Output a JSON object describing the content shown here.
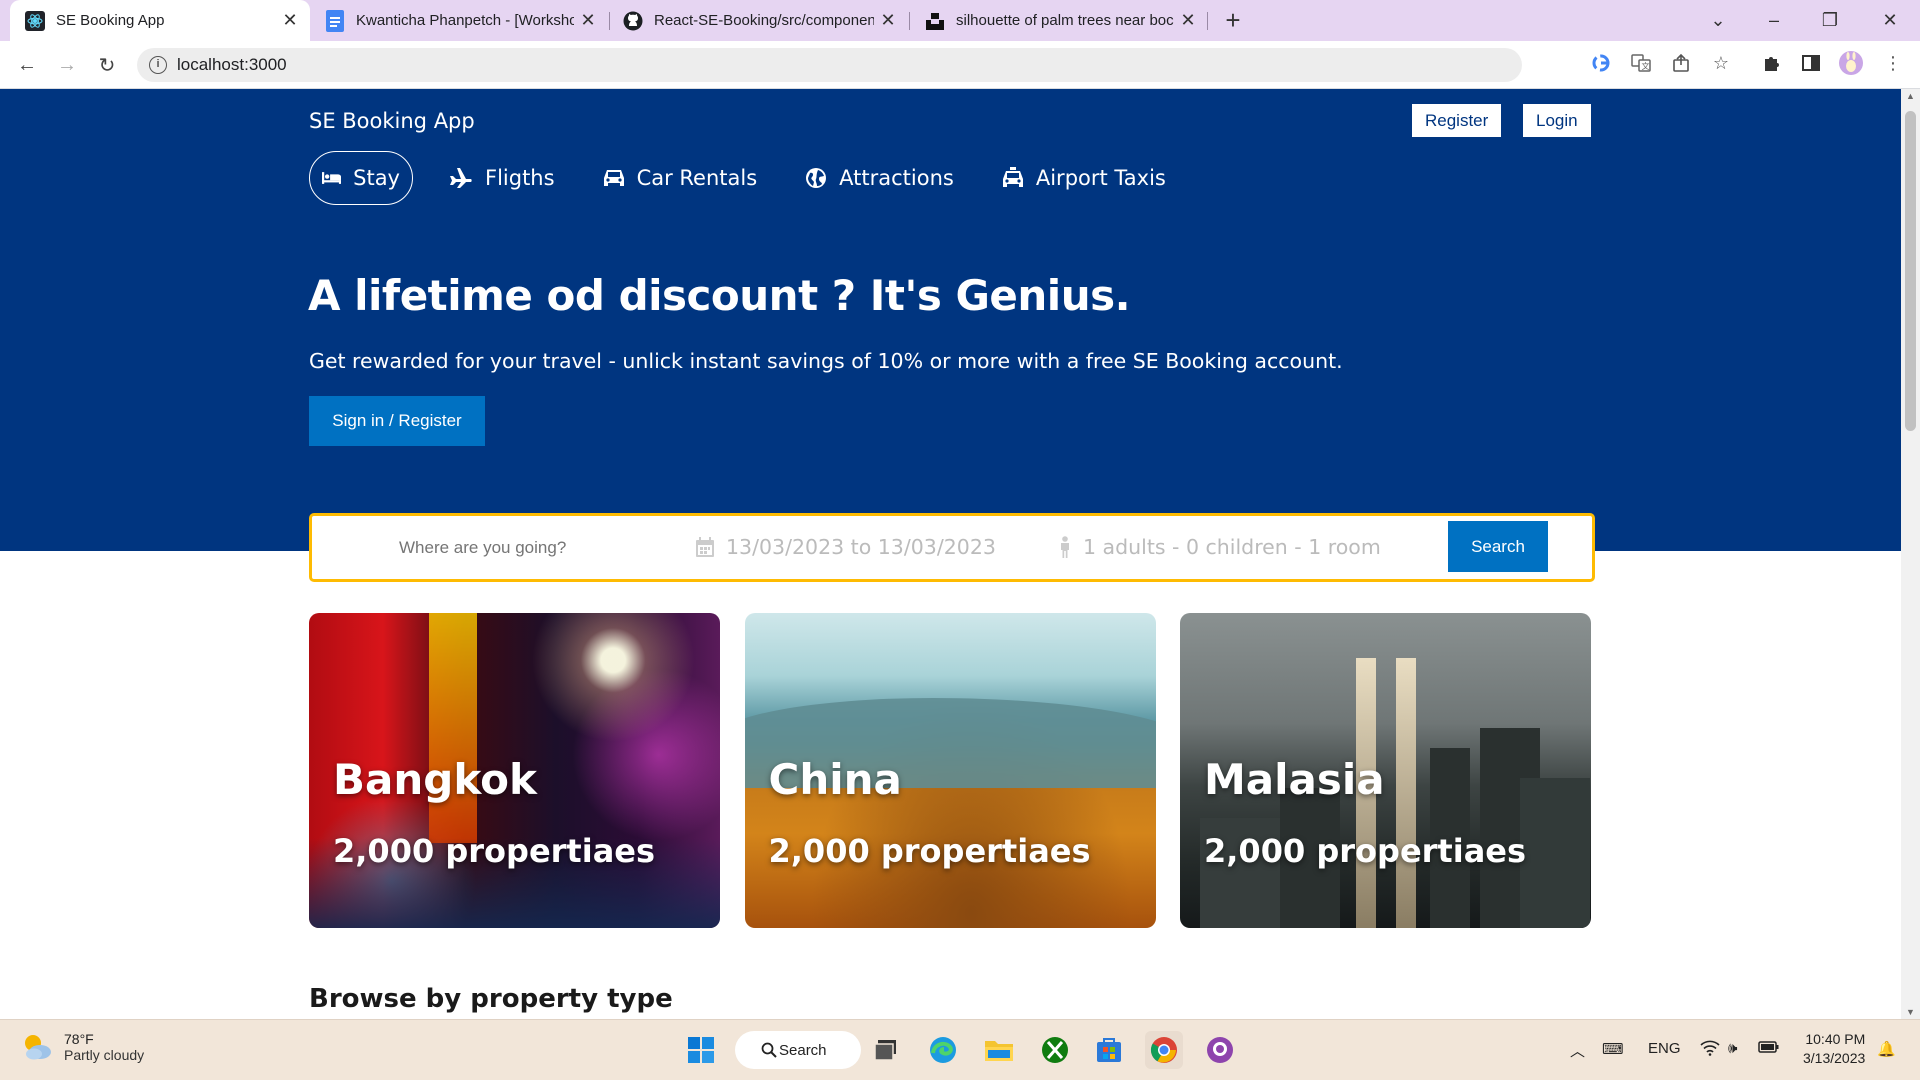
{
  "browser": {
    "tabs": [
      {
        "title": "SE Booking App",
        "active": true
      },
      {
        "title": "Kwanticha Phanpetch - [Worksho",
        "active": false
      },
      {
        "title": "React-SE-Booking/src/componen",
        "active": false
      },
      {
        "title": "silhouette of palm trees near boc",
        "active": false
      }
    ],
    "url": "localhost:3000"
  },
  "header": {
    "brand": "SE Booking App",
    "register_label": "Register",
    "login_label": "Login",
    "nav": [
      {
        "label": "Stay",
        "icon": "bed-icon",
        "active": true
      },
      {
        "label": "Fligths",
        "icon": "plane-icon",
        "active": false
      },
      {
        "label": "Car Rentals",
        "icon": "car-icon",
        "active": false
      },
      {
        "label": "Attractions",
        "icon": "globe-icon",
        "active": false
      },
      {
        "label": "Airport Taxis",
        "icon": "taxi-icon",
        "active": false
      }
    ],
    "title": "A lifetime od discount ? It's Genius.",
    "description": "Get rewarded for your travel - unlick instant savings of 10% or more with a free SE Booking account.",
    "signin_label": "Sign in / Register"
  },
  "search": {
    "placeholder": "Where are you going?",
    "date_range": "13/03/2023 to 13/03/2023",
    "options": "1 adults - 0 children - 1 room",
    "button_label": "Search"
  },
  "featured": [
    {
      "city": "Bangkok",
      "properties": "2,000 propertiaes"
    },
    {
      "city": "China",
      "properties": "2,000 propertiaes"
    },
    {
      "city": "Malasia",
      "properties": "2,000 propertiaes"
    }
  ],
  "section_title": "Browse by property type",
  "taskbar": {
    "temperature": "78°F",
    "weather": "Partly cloudy",
    "search_label": "Search",
    "language": "ENG",
    "time": "10:40 PM",
    "date": "3/13/2023"
  },
  "colors": {
    "brand_blue": "#003580",
    "button_blue": "#0071c2",
    "search_border": "#febb02"
  }
}
